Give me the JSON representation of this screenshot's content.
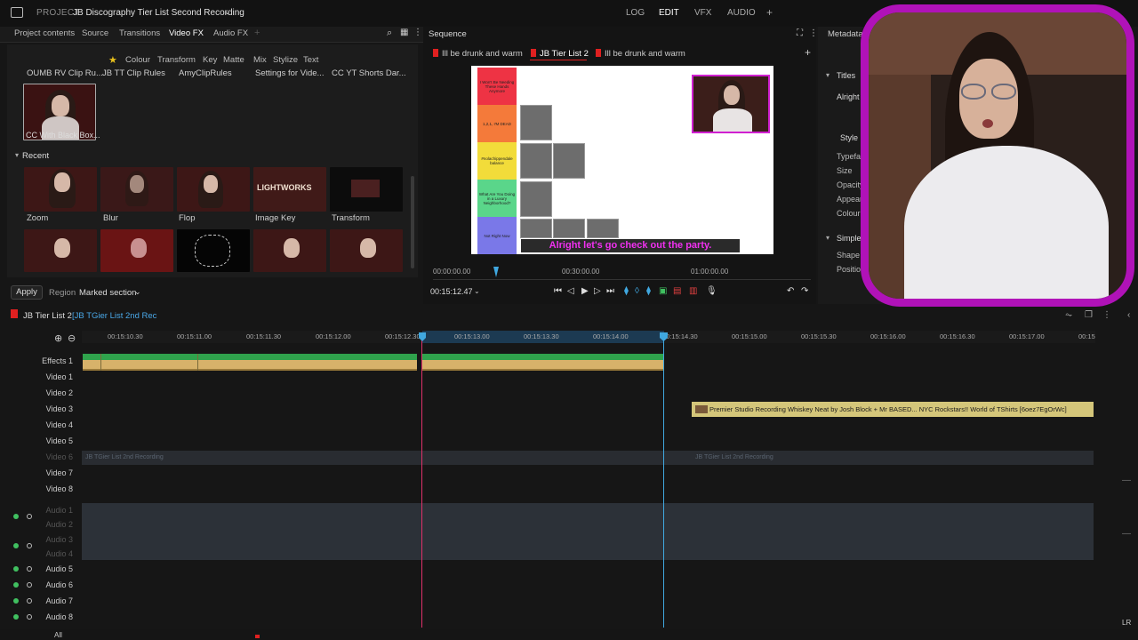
{
  "topbar": {
    "project_label": "PROJECT",
    "project_name": "JB Discography Tier List Second Recording",
    "modes": [
      "LOG",
      "EDIT",
      "VFX",
      "AUDIO"
    ],
    "add": "+"
  },
  "left_tabs": [
    "Project contents",
    "Source",
    "Transitions",
    "Video FX",
    "Audio FX"
  ],
  "fx_subtabs": [
    "Colour",
    "Transform",
    "Key",
    "Matte",
    "Mix",
    "Stylize",
    "Text"
  ],
  "presets": [
    "OUMB RV Clip Ru...",
    "JB TT Clip Rules",
    "AmyClipRules",
    "Settings for Vide...",
    "CC YT Shorts Dar..."
  ],
  "selected_preset": "CC With Black Box...",
  "recent_label": "Recent",
  "recent_fx": [
    "Zoom",
    "Blur",
    "Flop",
    "Image Key",
    "Transform"
  ],
  "lightworks_label": "LIGHTWORKS",
  "apply": "Apply",
  "region_label": "Region",
  "region_value": "Marked section",
  "sequence": {
    "title": "Sequence",
    "tabs": [
      "Ill be drunk and warm",
      "JB Tier List 2",
      "Ill be drunk and warm"
    ],
    "tiers": [
      {
        "label": "I Won't Be Needing These Hands Anymore",
        "color": "#ee3344"
      },
      {
        "label": "1,2,1, I'M DEAD",
        "color": "#f47a3a"
      },
      {
        "label": "#nolachippendale balance",
        "color": "#f2dc3a"
      },
      {
        "label": "What Are You Doing in a Luxury Neighborhood?",
        "color": "#5ad68a"
      },
      {
        "label": "Not Right Now",
        "color": "#7a78e8"
      }
    ],
    "subtitle": "Alright let's go check out the party.",
    "times": [
      "00:00:00.00",
      "00:30:00.00",
      "01:00:00.00"
    ],
    "timecode": "00:15:12.47"
  },
  "metadata": {
    "title": "Metadata",
    "section_titles": "Titles",
    "alright": "Alright",
    "style": "Style",
    "props": [
      "Typeface",
      "Size",
      "Opacity",
      "Appear",
      "Colour"
    ],
    "simple": "Simple",
    "shape": "Shape",
    "position": "Position"
  },
  "timeline": {
    "name": "JB Tier List 2",
    "name2": "[JB TGier List 2nd Rec",
    "ticks": [
      "00:15:10.30",
      "00:15:11.00",
      "00:15:11.30",
      "00:15:12.00",
      "00:15:12.30",
      "00:15:13.00",
      "00:15:13.30",
      "00:15:14.00",
      "00:15:14.30",
      "00:15:15.00",
      "00:15:15.30",
      "00:15:16.00",
      "00:15:16.30",
      "00:15:17.00",
      "00:15"
    ],
    "video_tracks": [
      "Effects 1",
      "Video 1",
      "Video 2",
      "Video 3",
      "Video 4",
      "Video 5",
      "Video 6",
      "Video 7",
      "Video 8"
    ],
    "audio_tracks": [
      "Audio 1",
      "Audio 2",
      "Audio 3",
      "Audio 4",
      "Audio 5",
      "Audio 6",
      "Audio 7",
      "Audio 8"
    ],
    "clip_premier": "Premier Studio Recording Whiskey Neat by Josh Block + Mr BASED... NYC Rockstars!! World of TShirts [6oez7EgOrWc]",
    "dim_clip": "JB TGier List 2nd Recording",
    "all": "All",
    "lr": "LR"
  }
}
